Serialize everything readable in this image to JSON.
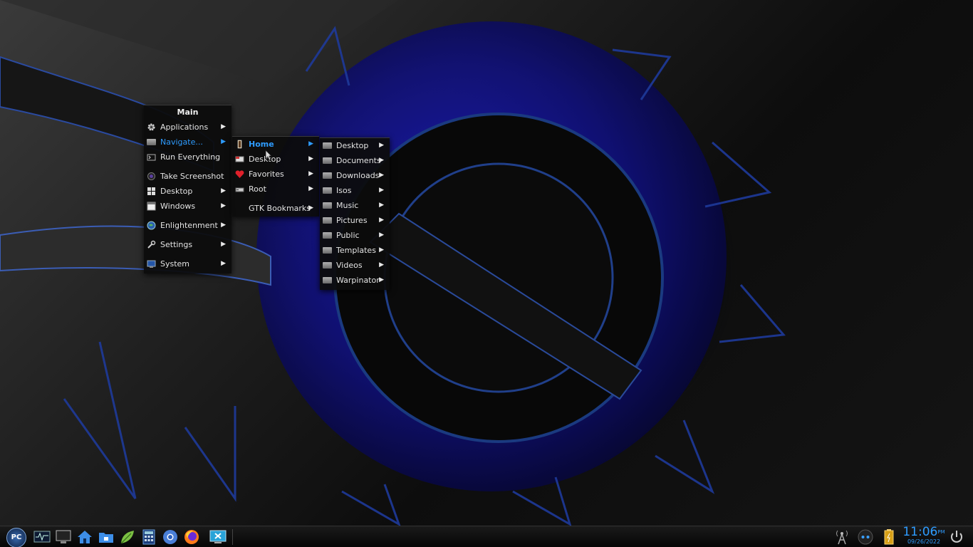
{
  "main_menu": {
    "title": "Main",
    "items": [
      {
        "label": "Applications",
        "icon": "gear-icon"
      },
      {
        "label": "Navigate...",
        "icon": "folder-icon"
      },
      {
        "label": "Run Everything",
        "icon": "terminal-icon"
      },
      {
        "label": "Take Screenshot",
        "icon": "camera-icon"
      },
      {
        "label": "Desktop",
        "icon": "grid-icon"
      },
      {
        "label": "Windows",
        "icon": "window-icon"
      },
      {
        "label": "Enlightenment",
        "icon": "globe-icon"
      },
      {
        "label": "Settings",
        "icon": "wrench-icon"
      },
      {
        "label": "System",
        "icon": "monitor-icon"
      }
    ]
  },
  "navigate_menu": {
    "items": [
      {
        "label": "Home",
        "icon": "home-icon"
      },
      {
        "label": "Desktop",
        "icon": "desktop-icon"
      },
      {
        "label": "Favorites",
        "icon": "heart-icon"
      },
      {
        "label": "Root",
        "icon": "drive-icon"
      },
      {
        "label": "GTK Bookmarks",
        "icon": ""
      }
    ]
  },
  "home_menu": {
    "items": [
      {
        "label": "Desktop"
      },
      {
        "label": "Documents"
      },
      {
        "label": "Downloads"
      },
      {
        "label": "Isos"
      },
      {
        "label": "Music"
      },
      {
        "label": "Pictures"
      },
      {
        "label": "Public"
      },
      {
        "label": "Templates"
      },
      {
        "label": "Videos"
      },
      {
        "label": "Warpinator"
      }
    ]
  },
  "taskbar": {
    "start_label": "PC",
    "launchers": [
      "system-monitor-icon",
      "desktop-screen-icon",
      "home-icon",
      "file-manager-icon",
      "leaf-icon",
      "calculator-icon",
      "browser-icon",
      "firefox-icon",
      "remote-desktop-icon"
    ],
    "tray": [
      "network-tower-icon",
      "mixer-icon",
      "battery-icon",
      "power-icon"
    ],
    "clock_time": "11:06",
    "clock_ampm": "PM",
    "clock_date": "09/26/2022"
  },
  "colors": {
    "accent": "#2e9cff",
    "menu_bg": "#0c0c0c",
    "wallpaper_blue": "#1a1aa8"
  }
}
